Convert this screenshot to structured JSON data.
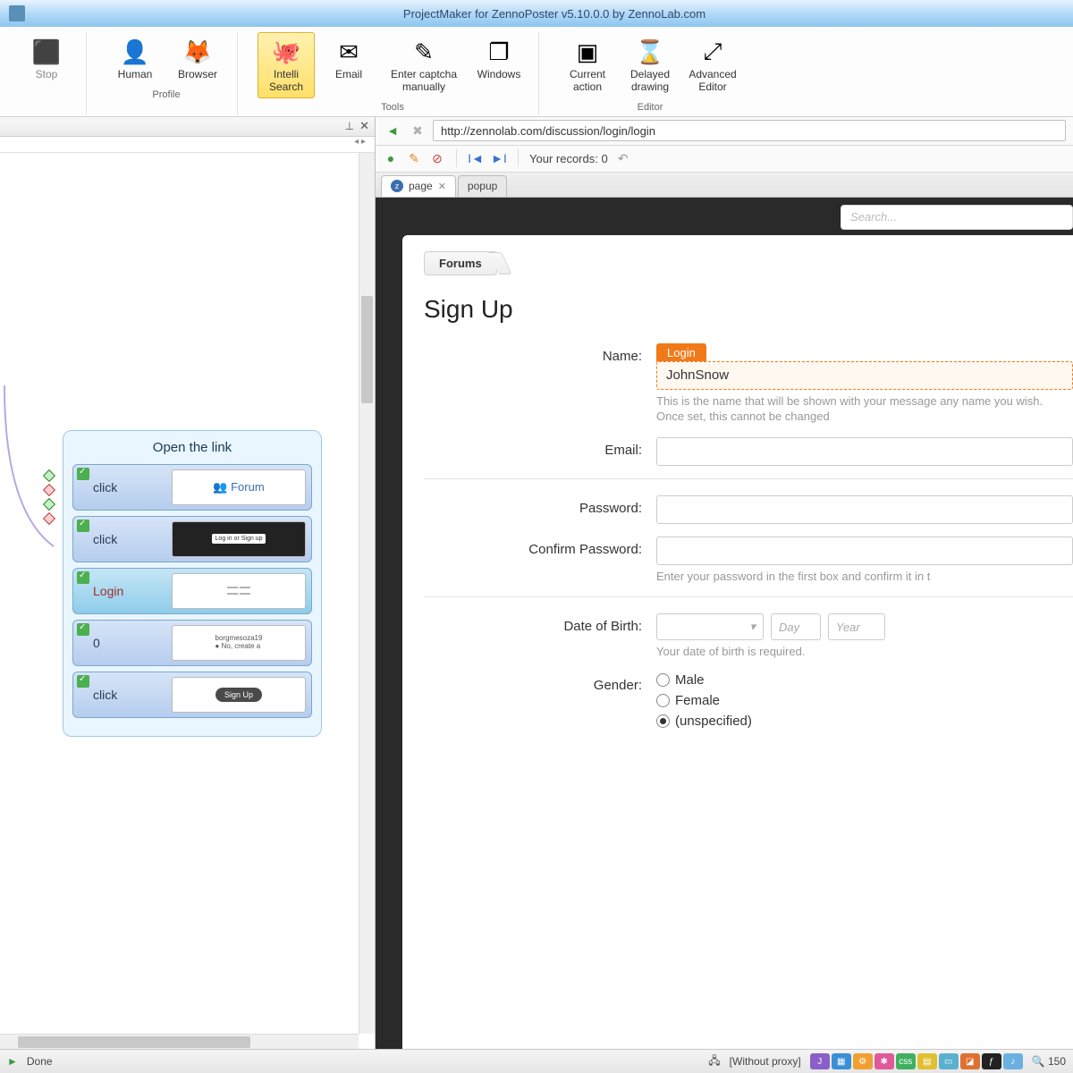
{
  "title": "ProjectMaker for ZennoPoster v5.10.0.0 by ZennoLab.com",
  "ribbon": {
    "groups": [
      {
        "title": "",
        "items": [
          {
            "id": "stop",
            "label": "Stop",
            "icon": "⬛",
            "disabled": true
          }
        ]
      },
      {
        "title": "Profile",
        "items": [
          {
            "id": "human",
            "label": "Human",
            "icon": "👤"
          },
          {
            "id": "browser",
            "label": "Browser",
            "icon": "🦊"
          }
        ]
      },
      {
        "title": "Tools",
        "items": [
          {
            "id": "intellisearch",
            "label": "Intelli\nSearch",
            "icon": "🐙",
            "active": true
          },
          {
            "id": "email",
            "label": "Email",
            "icon": "✉"
          },
          {
            "id": "captcha",
            "label": "Enter captcha\nmanually",
            "icon": "✎",
            "wide": true
          },
          {
            "id": "windows",
            "label": "Windows",
            "icon": "❐"
          }
        ]
      },
      {
        "title": "Editor",
        "items": [
          {
            "id": "current",
            "label": "Current\naction",
            "icon": "▣"
          },
          {
            "id": "delayed",
            "label": "Delayed\ndrawing",
            "icon": "⌛"
          },
          {
            "id": "advanced",
            "label": "Advanced\nEditor",
            "icon": "⤢"
          }
        ]
      }
    ]
  },
  "workflow": {
    "title": "Open the link",
    "steps": [
      {
        "label": "click",
        "thumb_text": "Forum",
        "variant": "forum"
      },
      {
        "label": "click",
        "thumb_text": "Log in or Sign up",
        "variant": "dark"
      },
      {
        "label": "Login",
        "thumb_text": "",
        "variant": "login"
      },
      {
        "label": "0",
        "thumb_text": "borgmesoza19\n● No, create a",
        "variant": "form"
      },
      {
        "label": "click",
        "thumb_text": "Sign Up",
        "variant": "button"
      }
    ]
  },
  "nav": {
    "url": "http://zennolab.com/discussion/login/login"
  },
  "recorder": {
    "records_label": "Your records:",
    "records_count": "0"
  },
  "tabs": [
    {
      "label": "page",
      "active": true
    },
    {
      "label": "popup",
      "active": false
    }
  ],
  "webpage": {
    "search_placeholder": "Search...",
    "breadcrumb": "Forums",
    "heading": "Sign Up",
    "login_tag": "Login",
    "fields": {
      "name_label": "Name:",
      "name_value": "JohnSnow",
      "name_hint": "This is the name that will be shown with your message any name you wish. Once set, this cannot be changed",
      "email_label": "Email:",
      "password_label": "Password:",
      "confirm_label": "Confirm Password:",
      "password_hint": "Enter your password in the first box and confirm it in t",
      "dob_label": "Date of Birth:",
      "dob_day": "Day",
      "dob_year": "Year",
      "dob_hint": "Your date of birth is required.",
      "gender_label": "Gender:",
      "gender_options": [
        "Male",
        "Female",
        "(unspecified)"
      ],
      "gender_selected": 2
    }
  },
  "status": {
    "done": "Done",
    "proxy": "[Without proxy]",
    "zoom": "150"
  }
}
